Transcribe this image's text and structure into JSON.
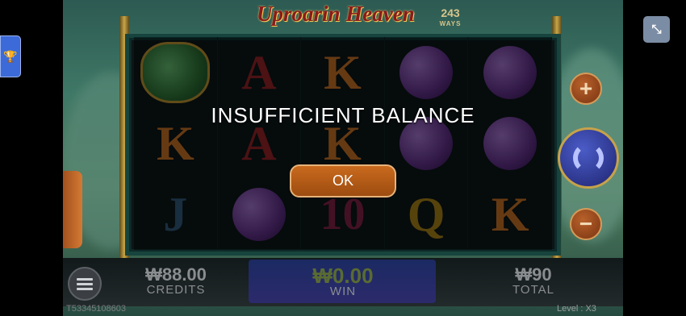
{
  "game": {
    "title": "Uproarin Heaven",
    "ways_value": "243",
    "ways_label": "WAYS"
  },
  "reels": [
    [
      "pot",
      "A",
      "K",
      "gourd",
      "gourd"
    ],
    [
      "K",
      "A",
      "K",
      "gourd",
      "gourd"
    ],
    [
      "J",
      "gourd",
      "10",
      "Q",
      "K"
    ]
  ],
  "dialog": {
    "message": "INSUFFICIENT BALANCE",
    "ok_label": "OK"
  },
  "stats": {
    "credits_value": "₩88.00",
    "credits_label": "CREDITS",
    "win_value": "₩0.00",
    "win_label": "WIN",
    "total_value": "₩90",
    "total_label": "TOTAL"
  },
  "footer": {
    "session_id": "T53345108603",
    "level": "Level : X3"
  },
  "controls": {
    "plus_symbol": "+",
    "minus_symbol": "−",
    "trophy_icon": "trophy-icon",
    "shrink_icon": "collapse-icon",
    "menu_icon": "menu-icon",
    "spin_icon": "spin-icon"
  },
  "colors": {
    "ok_button": "#b85c17",
    "spin_button": "#2b3590",
    "title_red": "#8b1a1a"
  }
}
